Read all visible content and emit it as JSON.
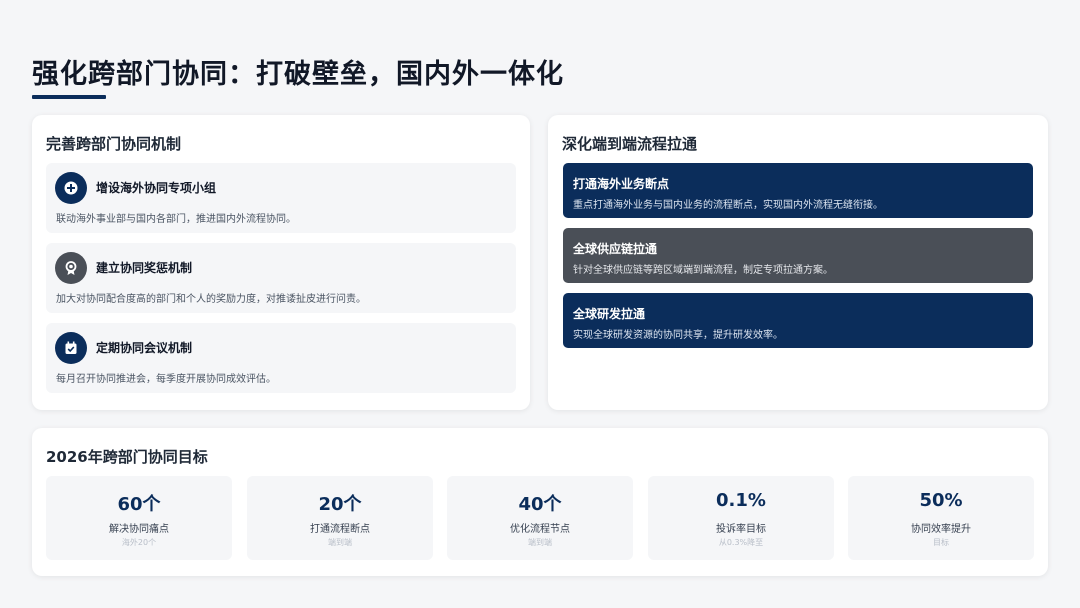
{
  "page": {
    "title": "强化跨部门协同：打破壁垒，国内外一体化"
  },
  "colors": {
    "navy": "#0b2d5b",
    "gray_card": "#4a4f57"
  },
  "mechanism": {
    "title": "完善跨部门协同机制",
    "items": [
      {
        "icon": "plus-circle-icon",
        "heading": "增设海外协同专项小组",
        "description": "联动海外事业部与国内各部门，推进国内外流程协同。"
      },
      {
        "icon": "award-icon",
        "heading": "建立协同奖惩机制",
        "description": "加大对协同配合度高的部门和个人的奖励力度，对推诿扯皮进行问责。"
      },
      {
        "icon": "calendar-check-icon",
        "heading": "定期协同会议机制",
        "description": "每月召开协同推进会，每季度开展协同成效评估。"
      }
    ]
  },
  "process": {
    "title": "深化端到端流程拉通",
    "items": [
      {
        "heading": "打通海外业务断点",
        "description": "重点打通海外业务与国内业务的流程断点，实现国内外流程无缝衔接。"
      },
      {
        "heading": "全球供应链拉通",
        "description": "针对全球供应链等跨区域端到端流程，制定专项拉通方案。"
      },
      {
        "heading": "全球研发拉通",
        "description": "实现全球研发资源的协同共享，提升研发效率。"
      }
    ]
  },
  "goals": {
    "title": "2026年跨部门协同目标",
    "items": [
      {
        "value": "60个",
        "label": "解决协同痛点",
        "note": "海外20个"
      },
      {
        "value": "20个",
        "label": "打通流程断点",
        "note": "端到端"
      },
      {
        "value": "40个",
        "label": "优化流程节点",
        "note": "端到端"
      },
      {
        "value": "0.1%",
        "label": "投诉率目标",
        "note": "从0.3%降至"
      },
      {
        "value": "50%",
        "label": "协同效率提升",
        "note": "目标"
      }
    ]
  }
}
